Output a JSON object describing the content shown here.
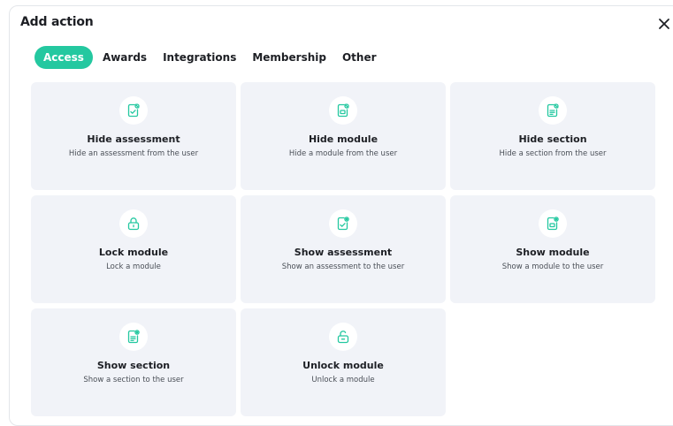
{
  "dialog": {
    "title": "Add action",
    "close_icon": "close-icon"
  },
  "tabs": [
    {
      "label": "Access",
      "active": true
    },
    {
      "label": "Awards",
      "active": false
    },
    {
      "label": "Integrations",
      "active": false
    },
    {
      "label": "Membership",
      "active": false
    },
    {
      "label": "Other",
      "active": false
    }
  ],
  "colors": {
    "accent": "#24c8a0",
    "card_bg": "#f1f3f8"
  },
  "actions": [
    {
      "title": "Hide assessment",
      "description": "Hide an assessment from the user",
      "icon": "document-check-hidden-icon"
    },
    {
      "title": "Hide module",
      "description": "Hide a module from the user",
      "icon": "document-hidden-icon"
    },
    {
      "title": "Hide section",
      "description": "Hide a section from the user",
      "icon": "document-lines-hidden-icon"
    },
    {
      "title": "Lock module",
      "description": "Lock a module",
      "icon": "lock-icon"
    },
    {
      "title": "Show assessment",
      "description": "Show an assessment to the user",
      "icon": "document-check-visible-icon"
    },
    {
      "title": "Show module",
      "description": "Show a module to the user",
      "icon": "document-visible-icon"
    },
    {
      "title": "Show section",
      "description": "Show a section to the user",
      "icon": "document-lines-visible-icon"
    },
    {
      "title": "Unlock module",
      "description": "Unlock a module",
      "icon": "unlock-icon"
    }
  ]
}
